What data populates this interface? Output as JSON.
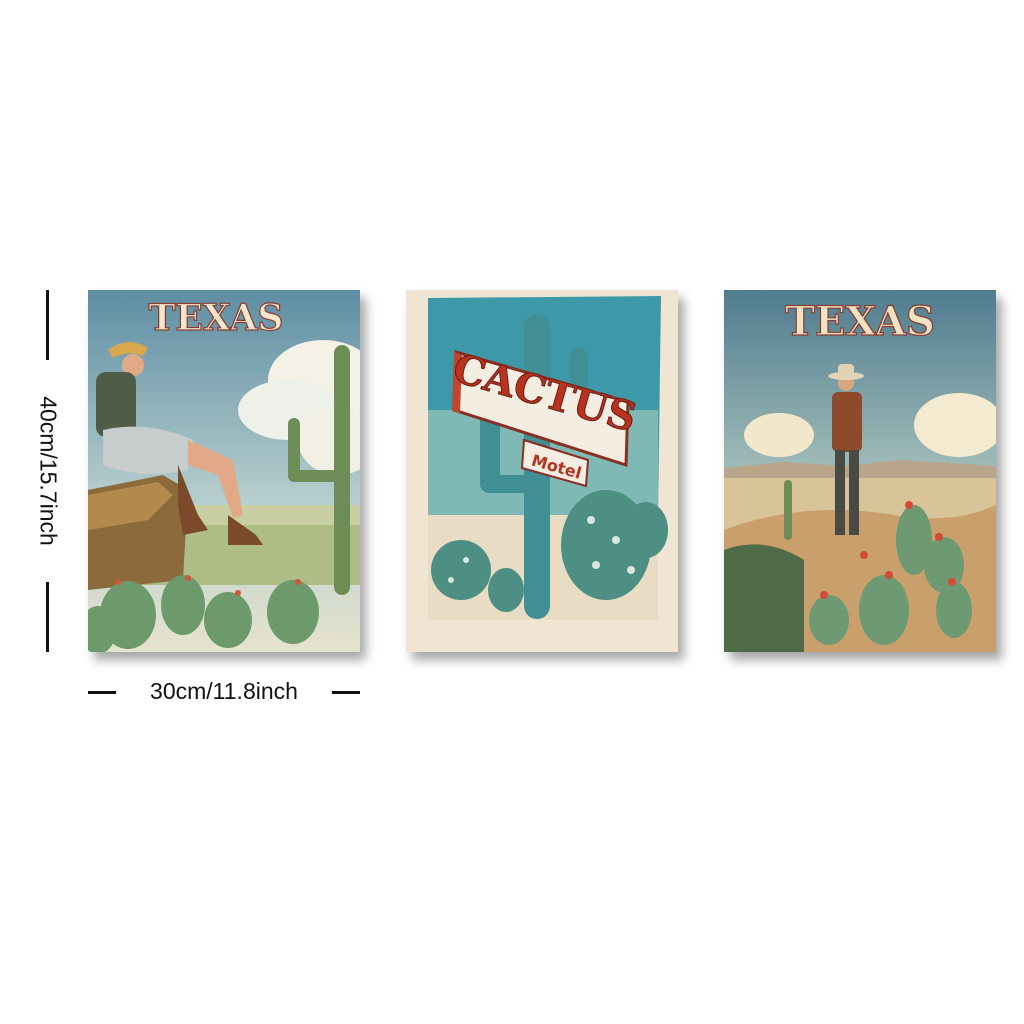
{
  "dimensions": {
    "height_label": "40cm/15.7inch",
    "width_label": "30cm/11.8inch"
  },
  "posters": [
    {
      "title": "TEXAS"
    },
    {
      "sign_main": "CACTUS",
      "sign_sub": "Motel"
    },
    {
      "title": "TEXAS"
    }
  ]
}
